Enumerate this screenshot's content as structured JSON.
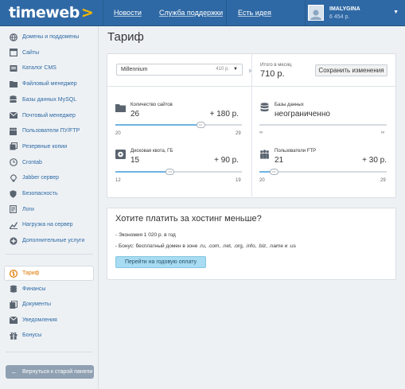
{
  "header": {
    "logo": "timeweb",
    "logo_arrow": ">",
    "nav": [
      "Новости",
      "Служба поддержки",
      "Есть идея"
    ],
    "user_name": "IMALYGINA",
    "user_balance": "6 454 р."
  },
  "sidebar": {
    "items": [
      {
        "label": "Домены и поддомены",
        "icon": "globe-icon"
      },
      {
        "label": "Сайты",
        "icon": "sites-icon"
      },
      {
        "label": "Каталог CMS",
        "icon": "catalog-icon"
      },
      {
        "label": "Файловый менеджер",
        "icon": "folder-icon"
      },
      {
        "label": "Базы данных MySQL",
        "icon": "database-icon"
      },
      {
        "label": "Почтовый менеджер",
        "icon": "mail-icon"
      },
      {
        "label": "Пользователи ПУ/FTP",
        "icon": "users-icon"
      },
      {
        "label": "Резервные копии",
        "icon": "backup-icon"
      },
      {
        "label": "Crontab",
        "icon": "clock-icon"
      },
      {
        "label": "Jabber сервер",
        "icon": "bulb-icon"
      },
      {
        "label": "Безопасность",
        "icon": "shield-icon"
      },
      {
        "label": "Логи",
        "icon": "logs-icon"
      },
      {
        "label": "Нагрузка на сервер",
        "icon": "chart-icon"
      },
      {
        "label": "Дополнительные услуги",
        "icon": "plus-icon"
      }
    ],
    "items2": [
      {
        "label": "Тариф",
        "icon": "tariff-icon",
        "active": true
      },
      {
        "label": "Финансы",
        "icon": "finance-icon"
      },
      {
        "label": "Документы",
        "icon": "documents-icon"
      },
      {
        "label": "Уведомления",
        "icon": "notifications-icon"
      },
      {
        "label": "Бонусы",
        "icon": "gift-icon"
      }
    ],
    "back_button": "Вернуться к старой панели"
  },
  "main": {
    "title": "Тариф",
    "tariff_select": {
      "name": "Millennium",
      "price": "410 р."
    },
    "monthly_total_label": "Итого в месяц",
    "monthly_total": "710 р.",
    "save_button": "Сохранить изменения",
    "resources": [
      {
        "label": "Количество сайтов",
        "value": "26",
        "add": "+ 180 р.",
        "min": "20",
        "max": "29",
        "level": 0.67,
        "icon": "folder-icon"
      },
      {
        "label": "Базы данных",
        "value": "неограниченно",
        "add": "",
        "min": "∞",
        "max": "∞",
        "level": null,
        "icon": "database-icon"
      },
      {
        "label": "Дисковая квота, ГБ",
        "value": "15",
        "add": "+ 90 р.",
        "min": "12",
        "max": "19",
        "level": 0.43,
        "icon": "disk-icon"
      },
      {
        "label": "Пользователи FTP",
        "value": "21",
        "add": "+ 30 р.",
        "min": "20",
        "max": "29",
        "level": 0.11,
        "icon": "ftp-users-icon"
      }
    ]
  },
  "offer": {
    "title": "Хотите платить за хостинг меньше?",
    "lines": [
      "- Экономия 1 020 р. в год",
      "- Бонус: бесплатный домен в зоне .ru, .com, .net, .org, .info, .biz, .name и .us"
    ],
    "button": "Перейти на годовую оплату"
  },
  "colors": {
    "accent": "#2f69a5",
    "link": "#2d6aa5",
    "active": "#e07800",
    "slider_fill": "#6fb4e1",
    "annual_button": "#a7dcf2"
  }
}
